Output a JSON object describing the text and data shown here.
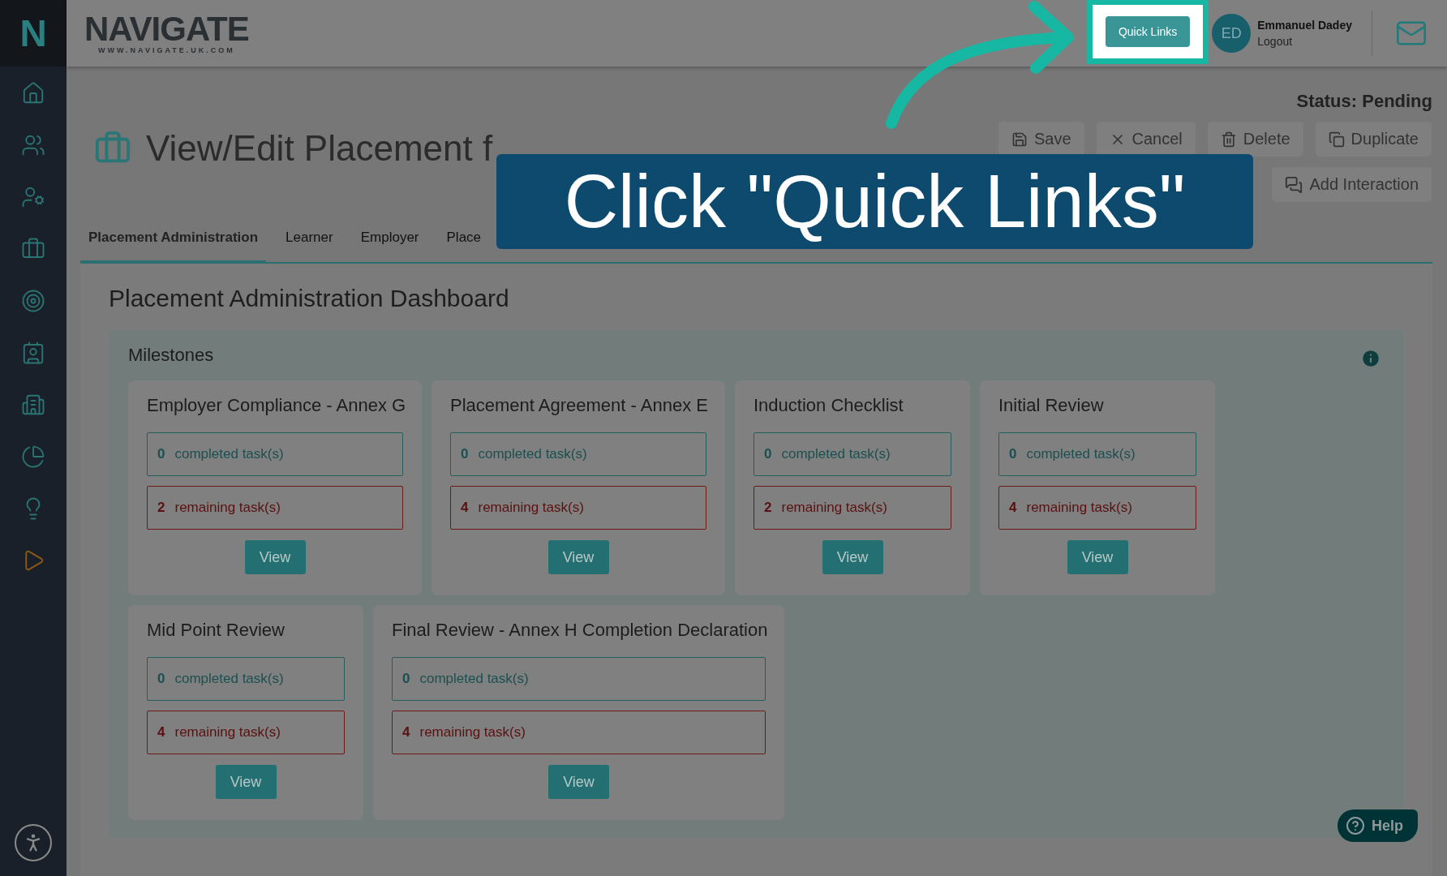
{
  "sidebar": {
    "logo": "N"
  },
  "header": {
    "logo": {
      "name": "NAVIGATE",
      "url": "WWW.NAVIGATE.UK.COM"
    },
    "quick_links": "Quick Links",
    "user": {
      "initials": "ED",
      "name": "Emmanuel Dadey",
      "logout": "Logout"
    }
  },
  "page": {
    "title": "View/Edit Placement f",
    "status": "Status: Pending",
    "actions": [
      {
        "label": "Save",
        "kind": "save"
      },
      {
        "label": "Cancel",
        "kind": "cancel"
      },
      {
        "label": "Delete",
        "kind": "delete"
      },
      {
        "label": "Duplicate",
        "kind": "duplicate"
      },
      {
        "label": "Add Interaction",
        "kind": "interaction"
      }
    ],
    "tabs": [
      {
        "label": "Placement Administration",
        "selected": true
      },
      {
        "label": "Learner",
        "selected": false
      },
      {
        "label": "Employer",
        "selected": false
      },
      {
        "label": "Place",
        "selected": false
      }
    ]
  },
  "dashboard": {
    "title": "Placement Administration Dashboard",
    "milestones": {
      "title": "Milestones",
      "cards": [
        {
          "title": "Employer Compliance - Annex G",
          "completed": "0",
          "completed_label": "completed task(s)",
          "remaining": "2",
          "remaining_label": "remaining task(s)",
          "button": "View"
        },
        {
          "title": "Placement Agreement - Annex E",
          "completed": "0",
          "completed_label": "completed task(s)",
          "remaining": "4",
          "remaining_label": "remaining task(s)",
          "button": "View"
        },
        {
          "title": "Induction Checklist",
          "completed": "0",
          "completed_label": "completed task(s)",
          "remaining": "2",
          "remaining_label": "remaining task(s)",
          "button": "View"
        },
        {
          "title": "Initial Review",
          "completed": "0",
          "completed_label": "completed task(s)",
          "remaining": "4",
          "remaining_label": "remaining task(s)",
          "button": "View"
        },
        {
          "title": "Mid Point Review",
          "completed": "0",
          "completed_label": "completed task(s)",
          "remaining": "4",
          "remaining_label": "remaining task(s)",
          "button": "View"
        },
        {
          "title": "Final Review - Annex H Completion Declaration",
          "completed": "0",
          "completed_label": "completed task(s)",
          "remaining": "4",
          "remaining_label": "remaining task(s)",
          "button": "View"
        }
      ]
    }
  },
  "help": "Help",
  "callout": "Click \"Quick Links\""
}
